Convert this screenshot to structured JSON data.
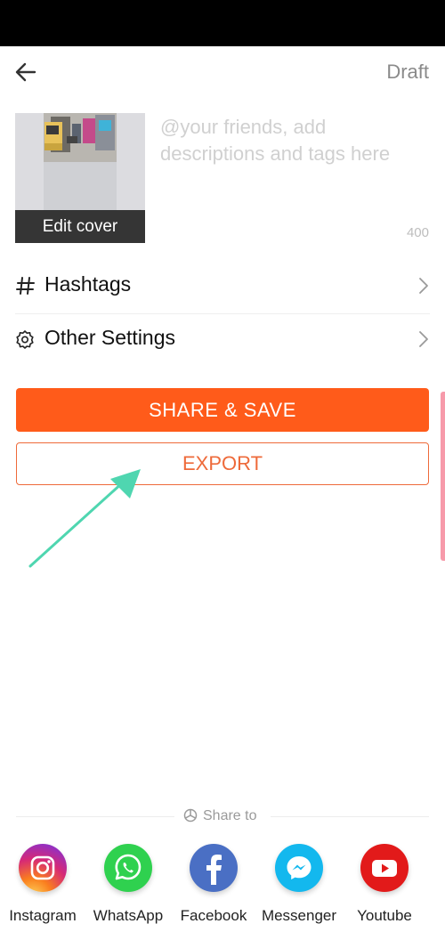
{
  "header": {
    "draft_label": "Draft"
  },
  "cover": {
    "edit_label": "Edit cover"
  },
  "description": {
    "placeholder": "@your friends, add descriptions and tags here",
    "remaining_chars": "400"
  },
  "settings_rows": [
    {
      "label": "Hashtags",
      "icon": "hash-icon"
    },
    {
      "label": "Other Settings",
      "icon": "gear-icon"
    }
  ],
  "actions": {
    "share_save_label": "SHARE & SAVE",
    "export_label": "EXPORT"
  },
  "share": {
    "title": "Share to",
    "apps": [
      {
        "name": "Instagram",
        "icon": "instagram-icon"
      },
      {
        "name": "WhatsApp",
        "icon": "whatsapp-icon"
      },
      {
        "name": "Facebook",
        "icon": "facebook-icon"
      },
      {
        "name": "Messenger",
        "icon": "messenger-icon"
      },
      {
        "name": "Youtube",
        "icon": "youtube-icon"
      }
    ]
  },
  "colors": {
    "accent": "#ff5b1a",
    "export_outline": "#ee6a3a",
    "annotation_arrow": "#4fd6b0"
  }
}
